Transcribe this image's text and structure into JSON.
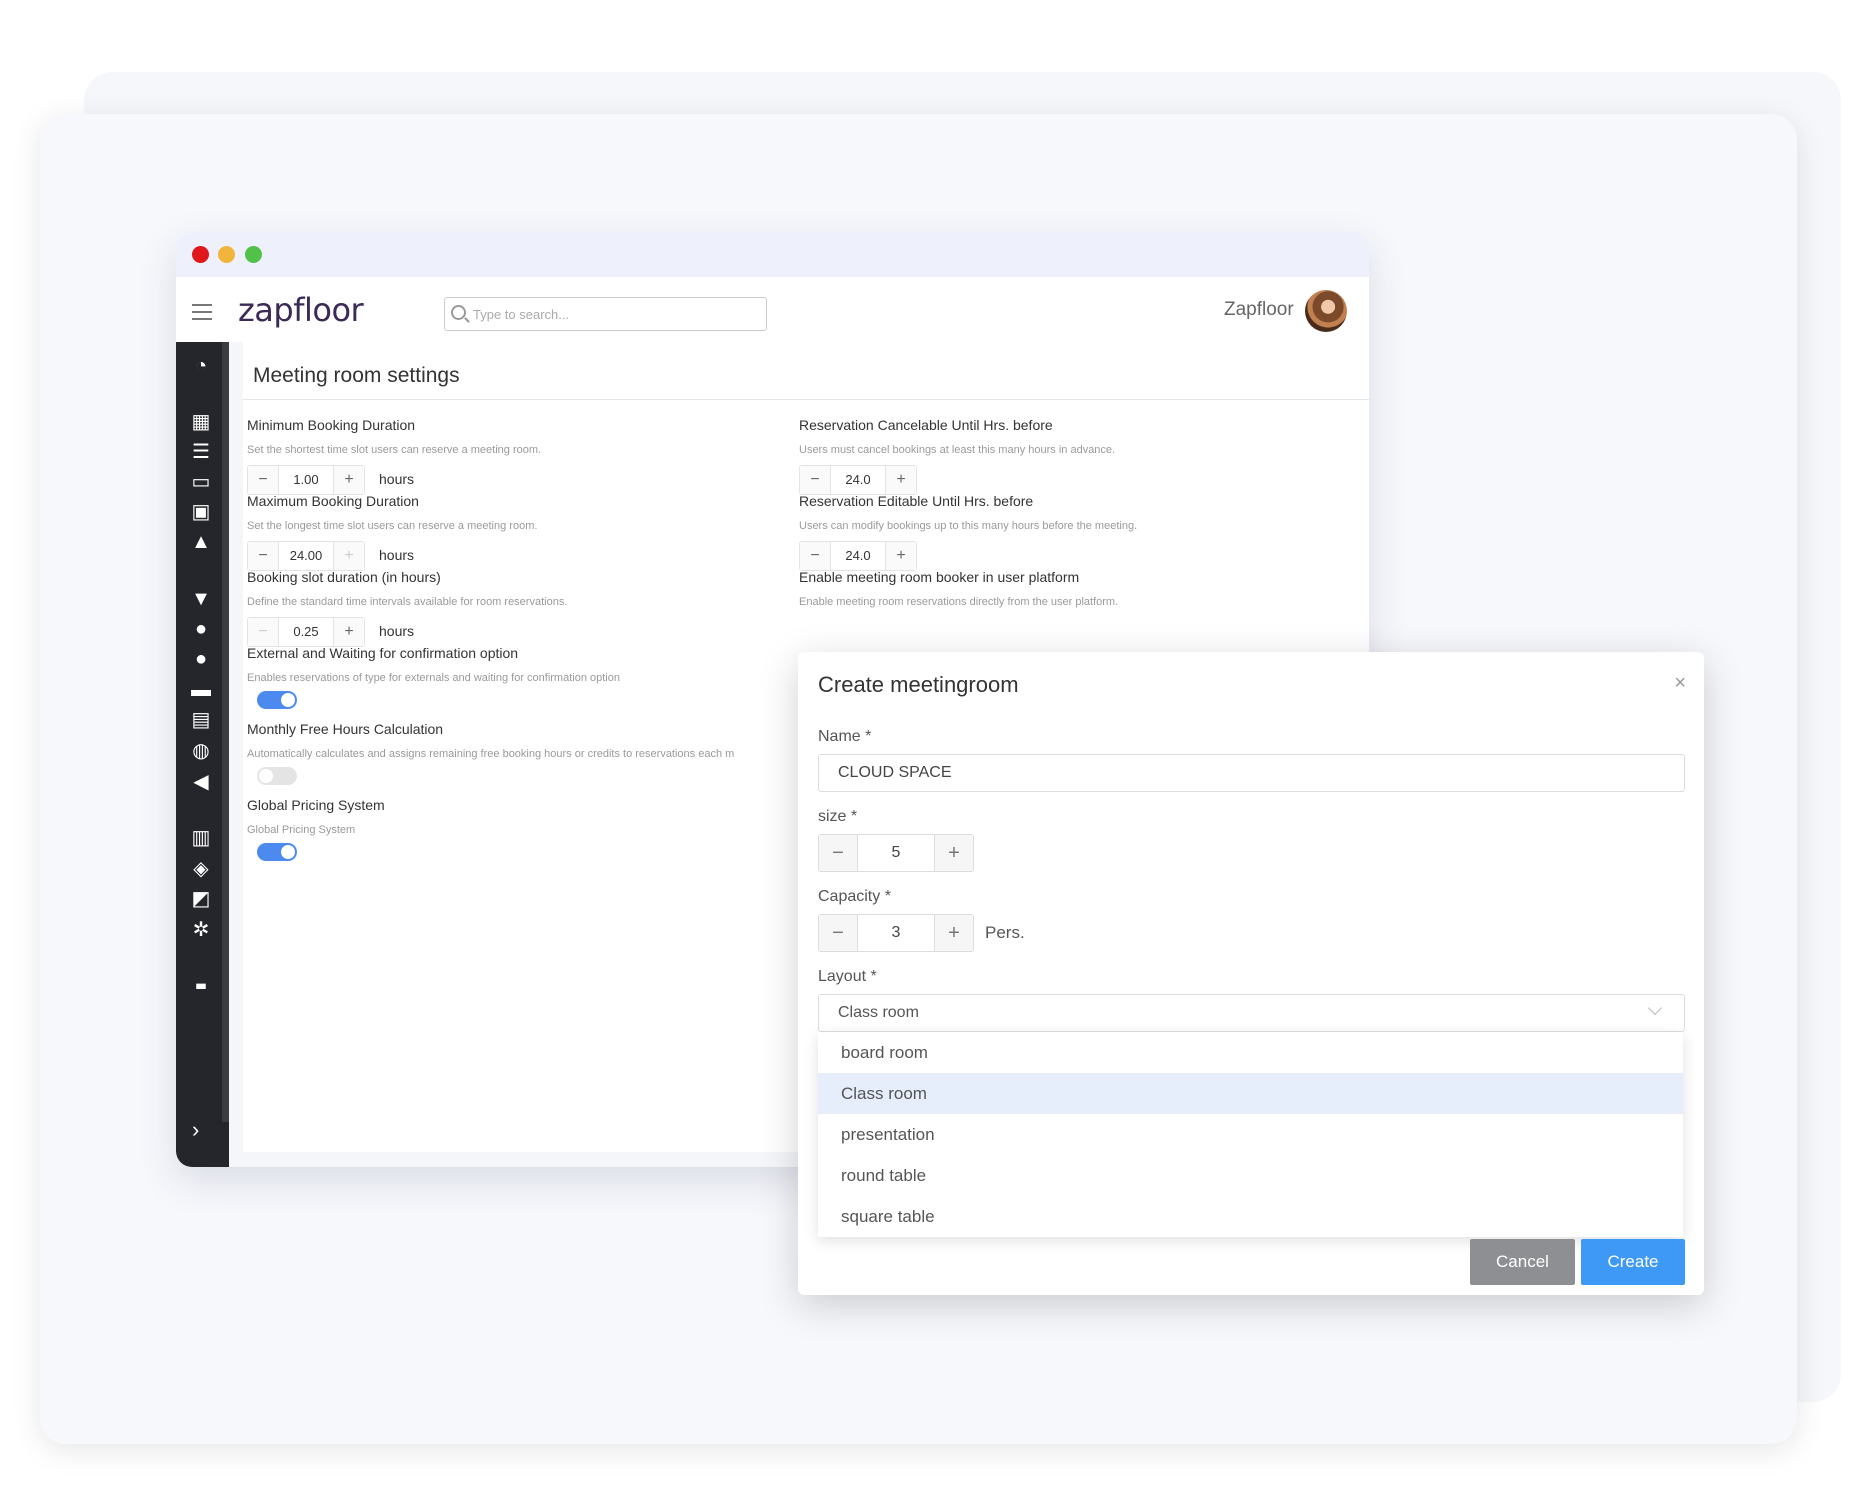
{
  "app": {
    "logo": "zapfloor",
    "user_name": "Zapfloor"
  },
  "search": {
    "placeholder": "Type to search..."
  },
  "page": {
    "title": "Meeting room settings"
  },
  "settings_left": [
    {
      "label": "Minimum Booking Duration",
      "description": "Set the shortest time slot users can reserve a meeting room.",
      "value": "1.00",
      "unit": "hours"
    },
    {
      "label": "Maximum Booking Duration",
      "description": "Set the longest time slot users can reserve a meeting room.",
      "value": "24.00",
      "unit": "hours"
    },
    {
      "label": "Booking slot duration (in hours)",
      "description": "Define the standard time intervals available for room reservations.",
      "value": "0.25",
      "unit": "hours"
    },
    {
      "label": "External and Waiting for confirmation option",
      "description": "Enables reservations of type for externals and waiting for confirmation option",
      "toggle": "on"
    },
    {
      "label": "Monthly Free Hours Calculation",
      "description": "Automatically calculates and assigns remaining free booking hours or credits to reservations each m",
      "toggle": "off"
    },
    {
      "label": "Global Pricing System",
      "description": "Global Pricing System",
      "toggle": "on"
    }
  ],
  "settings_right": [
    {
      "label": "Reservation Cancelable Until Hrs. before",
      "description": "Users must cancel bookings at least this many hours in advance.",
      "value": "24.0"
    },
    {
      "label": "Reservation Editable Until Hrs. before",
      "description": "Users can modify bookings up to this many hours before the meeting.",
      "value": "24.0"
    },
    {
      "label": "Enable meeting room booker in user platform",
      "description": "Enable meeting room reservations directly from the user platform."
    }
  ],
  "stepper": {
    "minus": "−",
    "plus": "+"
  },
  "modal": {
    "title": "Create meetingroom",
    "close": "×",
    "name_label": "Name *",
    "name_value": "CLOUD SPACE",
    "size_label": "size *",
    "size_value": "5",
    "capacity_label": "Capacity *",
    "capacity_value": "3",
    "capacity_unit": "Pers.",
    "layout_label": "Layout *",
    "layout_value": "Class room",
    "layout_options": [
      "board room",
      "Class room",
      "presentation",
      "round table",
      "square table"
    ],
    "cancel": "Cancel",
    "create": "Create"
  },
  "sidebar_icons": [
    "dashboard-icon",
    "calendar-icon",
    "list-icon",
    "desktop-icon",
    "contact-icon",
    "warning-icon",
    "filter-icon",
    "users-icon",
    "user-icon",
    "wallet-icon",
    "card-icon",
    "globe-icon",
    "megaphone-icon",
    "building-icon",
    "cubes-icon",
    "chart-icon",
    "gears-icon",
    "tray-icon"
  ],
  "colors": {
    "accent": "#3d99f5",
    "toggle_on": "#4d8af0",
    "sidebar": "#24262b"
  }
}
